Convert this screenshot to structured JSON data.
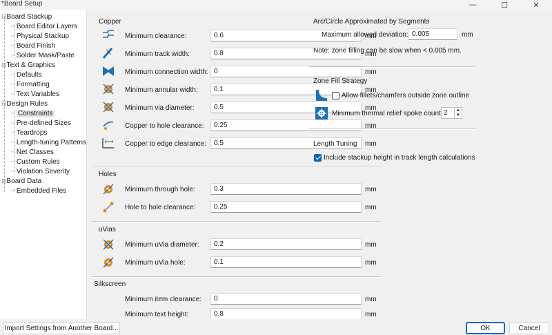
{
  "window": {
    "title": "*Board Setup",
    "minimize": "—",
    "maximize": "☐",
    "close": "✕"
  },
  "tree": {
    "board_stackup": "Board Stackup",
    "board_editor_layers": "Board Editor Layers",
    "physical_stackup": "Physical Stackup",
    "board_finish": "Board Finish",
    "solder_mask": "Solder Mask/Paste",
    "text_graphics": "Text & Graphics",
    "defaults": "Defaults",
    "formatting": "Formatting",
    "text_variables": "Text Variables",
    "design_rules": "Design Rules",
    "constraints": "Constraints",
    "predefined_sizes": "Pre-defined Sizes",
    "teardrops": "Teardrops",
    "length_tuning_patterns": "Length-tuning Patterns",
    "net_classes": "Net Classes",
    "custom_rules": "Custom Rules",
    "violation_severity": "Violation Severity",
    "board_data": "Board Data",
    "embedded_files": "Embedded Files"
  },
  "copper": {
    "title": "Copper",
    "rows": [
      {
        "label": "Minimum clearance:",
        "value": "0.6",
        "unit": "mm"
      },
      {
        "label": "Minimum track width:",
        "value": "0.8",
        "unit": "mm"
      },
      {
        "label": "Minimum connection width:",
        "value": "0",
        "unit": "mm"
      },
      {
        "label": "Minimum annular width:",
        "value": "0.1",
        "unit": "mm"
      },
      {
        "label": "Minimum via diameter:",
        "value": "0.5",
        "unit": "mm"
      },
      {
        "label": "Copper to hole clearance:",
        "value": "0.25",
        "unit": "mm"
      },
      {
        "label": "Copper to edge clearance:",
        "value": "0.5",
        "unit": "mm"
      }
    ]
  },
  "holes": {
    "title": "Holes",
    "rows": [
      {
        "label": "Minimum through hole:",
        "value": "0.3",
        "unit": "mm"
      },
      {
        "label": "Hole to hole clearance:",
        "value": "0.25",
        "unit": "mm"
      }
    ]
  },
  "uvias": {
    "title": "uVias",
    "rows": [
      {
        "label": "Minimum uVia diameter:",
        "value": "0.2",
        "unit": "mm"
      },
      {
        "label": "Minimum uVia hole:",
        "value": "0.1",
        "unit": "mm"
      }
    ]
  },
  "silkscreen": {
    "title": "Silkscreen",
    "rows": [
      {
        "label": "Minimum item clearance:",
        "value": "0",
        "unit": "mm"
      },
      {
        "label": "Minimum text height:",
        "value": "0.8",
        "unit": "mm"
      }
    ]
  },
  "arc": {
    "title": "Arc/Circle Approximated by Segments",
    "max_dev_label": "Maximum allowed deviation:",
    "max_dev_value": "0.005",
    "max_dev_unit": "mm",
    "note": "Note: zone filling can be slow when < 0.005 mm."
  },
  "zone": {
    "title": "Zone Fill Strategy",
    "fillets_label": "Allow fillets/chamfers outside zone outline",
    "fillets_checked": false,
    "spoke_label": "Minimum thermal relief spoke count:",
    "spoke_value": "2"
  },
  "length_tuning": {
    "title": "Length Tuning",
    "stackup_label": "Include stackup height in track length calculations",
    "stackup_checked": true
  },
  "buttons": {
    "import": "Import Settings from Another Board...",
    "ok": "OK",
    "cancel": "Cancel"
  },
  "colors": {
    "accent": "#0067c0",
    "icon_blue": "#1f6fb5",
    "icon_orange": "#e08a1e"
  }
}
